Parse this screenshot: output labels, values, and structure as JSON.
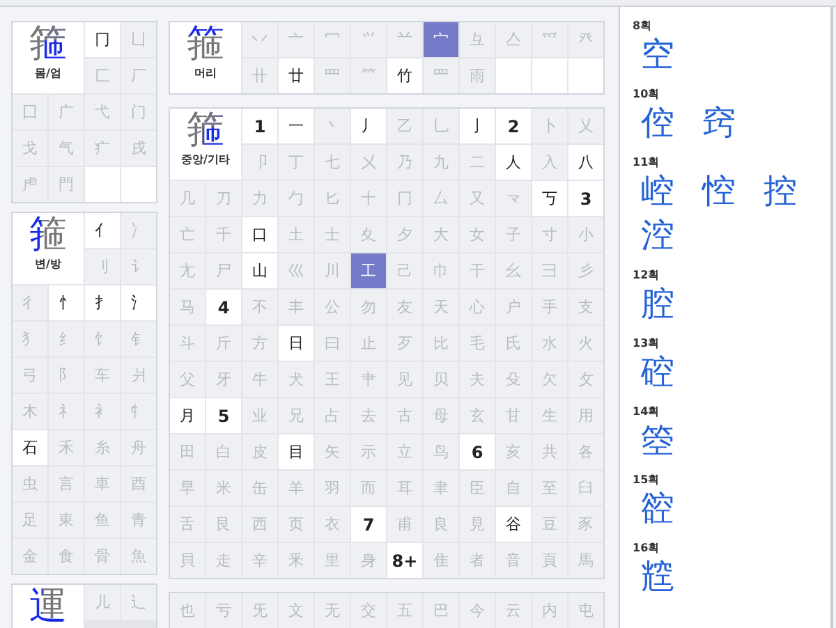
{
  "left_column": [
    {
      "label": "몸/엄",
      "char": "箍",
      "kind": "right",
      "cells": [
        {
          "kind": "radical",
          "text": "冂",
          "enabled": true,
          "selected": false
        },
        {
          "kind": "radical",
          "text": "凵",
          "enabled": false,
          "selected": false
        },
        {
          "kind": "radical",
          "text": "匚",
          "enabled": false,
          "selected": false
        },
        {
          "kind": "radical",
          "text": "厂",
          "enabled": false,
          "selected": false
        },
        {
          "kind": "radical",
          "text": "囗",
          "enabled": false,
          "selected": false
        },
        {
          "kind": "radical",
          "text": "广",
          "enabled": false,
          "selected": false
        },
        {
          "kind": "radical",
          "text": "弋",
          "enabled": false,
          "selected": false
        },
        {
          "kind": "radical",
          "text": "门",
          "enabled": false,
          "selected": false
        },
        {
          "kind": "radical",
          "text": "戈",
          "enabled": false,
          "selected": false
        },
        {
          "kind": "radical",
          "text": "气",
          "enabled": false,
          "selected": false
        },
        {
          "kind": "radical",
          "text": "疒",
          "enabled": false,
          "selected": false
        },
        {
          "kind": "radical",
          "text": "戌",
          "enabled": false,
          "selected": false
        },
        {
          "kind": "radical",
          "text": "虍",
          "enabled": false,
          "selected": false
        },
        {
          "kind": "radical",
          "text": "門",
          "enabled": false,
          "selected": false
        },
        {
          "kind": "empty"
        },
        {
          "kind": "empty"
        }
      ]
    },
    {
      "label": "변/방",
      "char": "箍",
      "kind": "left",
      "cells": [
        {
          "kind": "radical",
          "text": "亻",
          "enabled": true,
          "selected": false
        },
        {
          "kind": "radical",
          "text": "冫",
          "enabled": false,
          "selected": false
        },
        {
          "kind": "radical",
          "text": "刂",
          "enabled": false,
          "selected": false
        },
        {
          "kind": "radical",
          "text": "讠",
          "enabled": false,
          "selected": false
        },
        {
          "kind": "radical",
          "text": "彳",
          "enabled": false,
          "selected": false
        },
        {
          "kind": "radical",
          "text": "忄",
          "enabled": true,
          "selected": false
        },
        {
          "kind": "radical",
          "text": "扌",
          "enabled": true,
          "selected": false
        },
        {
          "kind": "radical",
          "text": "氵",
          "enabled": true,
          "selected": false
        },
        {
          "kind": "radical",
          "text": "犭",
          "enabled": false,
          "selected": false
        },
        {
          "kind": "radical",
          "text": "纟",
          "enabled": false,
          "selected": false
        },
        {
          "kind": "radical",
          "text": "饣",
          "enabled": false,
          "selected": false
        },
        {
          "kind": "radical",
          "text": "钅",
          "enabled": false,
          "selected": false
        },
        {
          "kind": "radical",
          "text": "弓",
          "enabled": false,
          "selected": false
        },
        {
          "kind": "radical",
          "text": "阝",
          "enabled": false,
          "selected": false
        },
        {
          "kind": "radical",
          "text": "车",
          "enabled": false,
          "selected": false
        },
        {
          "kind": "radical",
          "text": "爿",
          "enabled": false,
          "selected": false
        },
        {
          "kind": "radical",
          "text": "木",
          "enabled": false,
          "selected": false
        },
        {
          "kind": "radical",
          "text": "礻",
          "enabled": false,
          "selected": false
        },
        {
          "kind": "radical",
          "text": "衤",
          "enabled": false,
          "selected": false
        },
        {
          "kind": "radical",
          "text": "牜",
          "enabled": false,
          "selected": false
        },
        {
          "kind": "radical",
          "text": "石",
          "enabled": true,
          "selected": false
        },
        {
          "kind": "radical",
          "text": "禾",
          "enabled": false,
          "selected": false
        },
        {
          "kind": "radical",
          "text": "糸",
          "enabled": false,
          "selected": false
        },
        {
          "kind": "radical",
          "text": "舟",
          "enabled": false,
          "selected": false
        },
        {
          "kind": "radical",
          "text": "虫",
          "enabled": false,
          "selected": false
        },
        {
          "kind": "radical",
          "text": "言",
          "enabled": false,
          "selected": false
        },
        {
          "kind": "radical",
          "text": "車",
          "enabled": false,
          "selected": false
        },
        {
          "kind": "radical",
          "text": "酉",
          "enabled": false,
          "selected": false
        },
        {
          "kind": "radical",
          "text": "足",
          "enabled": false,
          "selected": false
        },
        {
          "kind": "radical",
          "text": "東",
          "enabled": false,
          "selected": false
        },
        {
          "kind": "radical",
          "text": "鱼",
          "enabled": false,
          "selected": false
        },
        {
          "kind": "radical",
          "text": "青",
          "enabled": false,
          "selected": false
        },
        {
          "kind": "radical",
          "text": "金",
          "enabled": false,
          "selected": false
        },
        {
          "kind": "radical",
          "text": "食",
          "enabled": false,
          "selected": false
        },
        {
          "kind": "radical",
          "text": "骨",
          "enabled": false,
          "selected": false
        },
        {
          "kind": "radical",
          "text": "魚",
          "enabled": false,
          "selected": false
        }
      ]
    },
    {
      "char": "運",
      "kind": "leftbottom",
      "cells": [
        {
          "kind": "radical",
          "text": "儿",
          "enabled": false,
          "selected": false
        },
        {
          "kind": "radical",
          "text": "辶",
          "enabled": false,
          "selected": false
        }
      ]
    }
  ],
  "middle_column": [
    {
      "label": "머리",
      "char": "箍",
      "kind": "top",
      "cells": [
        {
          "kind": "radical",
          "text": "丷",
          "enabled": false,
          "selected": false
        },
        {
          "kind": "radical",
          "text": "亠",
          "enabled": false,
          "selected": false
        },
        {
          "kind": "radical",
          "text": "冖",
          "enabled": false,
          "selected": false
        },
        {
          "kind": "radical",
          "text": "⺍",
          "enabled": false,
          "selected": false
        },
        {
          "kind": "radical",
          "text": "䒑",
          "enabled": false,
          "selected": false
        },
        {
          "kind": "radical",
          "text": "宀",
          "enabled": true,
          "selected": true
        },
        {
          "kind": "radical",
          "text": "彑",
          "enabled": false,
          "selected": false
        },
        {
          "kind": "radical",
          "text": "亼",
          "enabled": false,
          "selected": false
        },
        {
          "kind": "radical",
          "text": "爫",
          "enabled": false,
          "selected": false
        },
        {
          "kind": "radical",
          "text": "癶",
          "enabled": false,
          "selected": false
        },
        {
          "kind": "radical",
          "text": "卄",
          "enabled": false,
          "selected": false
        },
        {
          "kind": "radical",
          "text": "廿",
          "enabled": true,
          "selected": false
        },
        {
          "kind": "radical",
          "text": "罒",
          "enabled": false,
          "selected": false
        },
        {
          "kind": "radical",
          "text": "⺮",
          "enabled": false,
          "selected": false
        },
        {
          "kind": "radical",
          "text": "竹",
          "enabled": true,
          "selected": false
        },
        {
          "kind": "radical",
          "text": "⺲",
          "enabled": false,
          "selected": false
        },
        {
          "kind": "radical",
          "text": "雨",
          "enabled": false,
          "selected": false
        },
        {
          "kind": "empty"
        },
        {
          "kind": "empty"
        },
        {
          "kind": "empty"
        }
      ]
    },
    {
      "label": "중앙/기타",
      "char": "箍",
      "kind": "center",
      "cells": [
        {
          "kind": "stroke",
          "text": "1"
        },
        {
          "kind": "radical",
          "text": "一",
          "enabled": true,
          "selected": false
        },
        {
          "kind": "radical",
          "text": "丶",
          "enabled": false,
          "selected": false
        },
        {
          "kind": "radical",
          "text": "丿",
          "enabled": true,
          "selected": false
        },
        {
          "kind": "radical",
          "text": "乙",
          "enabled": false,
          "selected": false
        },
        {
          "kind": "radical",
          "text": "乚",
          "enabled": false,
          "selected": false
        },
        {
          "kind": "radical",
          "text": "亅",
          "enabled": true,
          "selected": false
        },
        {
          "kind": "stroke",
          "text": "2"
        },
        {
          "kind": "radical",
          "text": "卜",
          "enabled": false,
          "selected": false
        },
        {
          "kind": "radical",
          "text": "乂",
          "enabled": false,
          "selected": false
        },
        {
          "kind": "radical",
          "text": "卩",
          "enabled": false,
          "selected": false
        },
        {
          "kind": "radical",
          "text": "丁",
          "enabled": false,
          "selected": false
        },
        {
          "kind": "radical",
          "text": "七",
          "enabled": false,
          "selected": false
        },
        {
          "kind": "radical",
          "text": "㐅",
          "enabled": false,
          "selected": false
        },
        {
          "kind": "radical",
          "text": "乃",
          "enabled": false,
          "selected": false
        },
        {
          "kind": "radical",
          "text": "九",
          "enabled": false,
          "selected": false
        },
        {
          "kind": "radical",
          "text": "二",
          "enabled": false,
          "selected": false
        },
        {
          "kind": "radical",
          "text": "人",
          "enabled": true,
          "selected": false
        },
        {
          "kind": "radical",
          "text": "入",
          "enabled": false,
          "selected": false
        },
        {
          "kind": "radical",
          "text": "八",
          "enabled": true,
          "selected": false
        },
        {
          "kind": "radical",
          "text": "几",
          "enabled": false,
          "selected": false
        },
        {
          "kind": "radical",
          "text": "刀",
          "enabled": false,
          "selected": false
        },
        {
          "kind": "radical",
          "text": "力",
          "enabled": false,
          "selected": false
        },
        {
          "kind": "radical",
          "text": "勹",
          "enabled": false,
          "selected": false
        },
        {
          "kind": "radical",
          "text": "匕",
          "enabled": false,
          "selected": false
        },
        {
          "kind": "radical",
          "text": "十",
          "enabled": false,
          "selected": false
        },
        {
          "kind": "radical",
          "text": "冂",
          "enabled": false,
          "selected": false
        },
        {
          "kind": "radical",
          "text": "厶",
          "enabled": false,
          "selected": false
        },
        {
          "kind": "radical",
          "text": "又",
          "enabled": false,
          "selected": false
        },
        {
          "kind": "radical",
          "text": "龴",
          "enabled": false,
          "selected": false
        },
        {
          "kind": "radical",
          "text": "丂",
          "enabled": true,
          "selected": false
        },
        {
          "kind": "stroke",
          "text": "3"
        },
        {
          "kind": "radical",
          "text": "亡",
          "enabled": false,
          "selected": false
        },
        {
          "kind": "radical",
          "text": "千",
          "enabled": false,
          "selected": false
        },
        {
          "kind": "radical",
          "text": "口",
          "enabled": true,
          "selected": false
        },
        {
          "kind": "radical",
          "text": "土",
          "enabled": false,
          "selected": false
        },
        {
          "kind": "radical",
          "text": "士",
          "enabled": false,
          "selected": false
        },
        {
          "kind": "radical",
          "text": "夊",
          "enabled": false,
          "selected": false
        },
        {
          "kind": "radical",
          "text": "夕",
          "enabled": false,
          "selected": false
        },
        {
          "kind": "radical",
          "text": "大",
          "enabled": false,
          "selected": false
        },
        {
          "kind": "radical",
          "text": "女",
          "enabled": false,
          "selected": false
        },
        {
          "kind": "radical",
          "text": "子",
          "enabled": false,
          "selected": false
        },
        {
          "kind": "radical",
          "text": "寸",
          "enabled": false,
          "selected": false
        },
        {
          "kind": "radical",
          "text": "小",
          "enabled": false,
          "selected": false
        },
        {
          "kind": "radical",
          "text": "尢",
          "enabled": false,
          "selected": false
        },
        {
          "kind": "radical",
          "text": "尸",
          "enabled": false,
          "selected": false
        },
        {
          "kind": "radical",
          "text": "山",
          "enabled": true,
          "selected": false
        },
        {
          "kind": "radical",
          "text": "巛",
          "enabled": false,
          "selected": false
        },
        {
          "kind": "radical",
          "text": "川",
          "enabled": false,
          "selected": false
        },
        {
          "kind": "radical",
          "text": "工",
          "enabled": true,
          "selected": true
        },
        {
          "kind": "radical",
          "text": "己",
          "enabled": false,
          "selected": false
        },
        {
          "kind": "radical",
          "text": "巾",
          "enabled": false,
          "selected": false
        },
        {
          "kind": "radical",
          "text": "干",
          "enabled": false,
          "selected": false
        },
        {
          "kind": "radical",
          "text": "幺",
          "enabled": false,
          "selected": false
        },
        {
          "kind": "radical",
          "text": "彐",
          "enabled": false,
          "selected": false
        },
        {
          "kind": "radical",
          "text": "彡",
          "enabled": false,
          "selected": false
        },
        {
          "kind": "radical",
          "text": "马",
          "enabled": false,
          "selected": false
        },
        {
          "kind": "stroke",
          "text": "4"
        },
        {
          "kind": "radical",
          "text": "不",
          "enabled": false,
          "selected": false
        },
        {
          "kind": "radical",
          "text": "丰",
          "enabled": false,
          "selected": false
        },
        {
          "kind": "radical",
          "text": "公",
          "enabled": false,
          "selected": false
        },
        {
          "kind": "radical",
          "text": "勿",
          "enabled": false,
          "selected": false
        },
        {
          "kind": "radical",
          "text": "友",
          "enabled": false,
          "selected": false
        },
        {
          "kind": "radical",
          "text": "天",
          "enabled": false,
          "selected": false
        },
        {
          "kind": "radical",
          "text": "心",
          "enabled": false,
          "selected": false
        },
        {
          "kind": "radical",
          "text": "户",
          "enabled": false,
          "selected": false
        },
        {
          "kind": "radical",
          "text": "手",
          "enabled": false,
          "selected": false
        },
        {
          "kind": "radical",
          "text": "支",
          "enabled": false,
          "selected": false
        },
        {
          "kind": "radical",
          "text": "斗",
          "enabled": false,
          "selected": false
        },
        {
          "kind": "radical",
          "text": "斤",
          "enabled": false,
          "selected": false
        },
        {
          "kind": "radical",
          "text": "方",
          "enabled": false,
          "selected": false
        },
        {
          "kind": "radical",
          "text": "日",
          "enabled": true,
          "selected": false
        },
        {
          "kind": "radical",
          "text": "曰",
          "enabled": false,
          "selected": false
        },
        {
          "kind": "radical",
          "text": "止",
          "enabled": false,
          "selected": false
        },
        {
          "kind": "radical",
          "text": "歹",
          "enabled": false,
          "selected": false
        },
        {
          "kind": "radical",
          "text": "比",
          "enabled": false,
          "selected": false
        },
        {
          "kind": "radical",
          "text": "毛",
          "enabled": false,
          "selected": false
        },
        {
          "kind": "radical",
          "text": "氏",
          "enabled": false,
          "selected": false
        },
        {
          "kind": "radical",
          "text": "水",
          "enabled": false,
          "selected": false
        },
        {
          "kind": "radical",
          "text": "火",
          "enabled": false,
          "selected": false
        },
        {
          "kind": "radical",
          "text": "父",
          "enabled": false,
          "selected": false
        },
        {
          "kind": "radical",
          "text": "牙",
          "enabled": false,
          "selected": false
        },
        {
          "kind": "radical",
          "text": "牛",
          "enabled": false,
          "selected": false
        },
        {
          "kind": "radical",
          "text": "犬",
          "enabled": false,
          "selected": false
        },
        {
          "kind": "radical",
          "text": "王",
          "enabled": false,
          "selected": false
        },
        {
          "kind": "radical",
          "text": "肀",
          "enabled": false,
          "selected": false
        },
        {
          "kind": "radical",
          "text": "见",
          "enabled": false,
          "selected": false
        },
        {
          "kind": "radical",
          "text": "贝",
          "enabled": false,
          "selected": false
        },
        {
          "kind": "radical",
          "text": "夫",
          "enabled": false,
          "selected": false
        },
        {
          "kind": "radical",
          "text": "殳",
          "enabled": false,
          "selected": false
        },
        {
          "kind": "radical",
          "text": "欠",
          "enabled": false,
          "selected": false
        },
        {
          "kind": "radical",
          "text": "攵",
          "enabled": false,
          "selected": false
        },
        {
          "kind": "radical",
          "text": "月",
          "enabled": true,
          "selected": false
        },
        {
          "kind": "stroke",
          "text": "5"
        },
        {
          "kind": "radical",
          "text": "业",
          "enabled": false,
          "selected": false
        },
        {
          "kind": "radical",
          "text": "兄",
          "enabled": false,
          "selected": false
        },
        {
          "kind": "radical",
          "text": "占",
          "enabled": false,
          "selected": false
        },
        {
          "kind": "radical",
          "text": "去",
          "enabled": false,
          "selected": false
        },
        {
          "kind": "radical",
          "text": "古",
          "enabled": false,
          "selected": false
        },
        {
          "kind": "radical",
          "text": "母",
          "enabled": false,
          "selected": false
        },
        {
          "kind": "radical",
          "text": "玄",
          "enabled": false,
          "selected": false
        },
        {
          "kind": "radical",
          "text": "甘",
          "enabled": false,
          "selected": false
        },
        {
          "kind": "radical",
          "text": "生",
          "enabled": false,
          "selected": false
        },
        {
          "kind": "radical",
          "text": "用",
          "enabled": false,
          "selected": false
        },
        {
          "kind": "radical",
          "text": "田",
          "enabled": false,
          "selected": false
        },
        {
          "kind": "radical",
          "text": "白",
          "enabled": false,
          "selected": false
        },
        {
          "kind": "radical",
          "text": "皮",
          "enabled": false,
          "selected": false
        },
        {
          "kind": "radical",
          "text": "目",
          "enabled": true,
          "selected": false
        },
        {
          "kind": "radical",
          "text": "矢",
          "enabled": false,
          "selected": false
        },
        {
          "kind": "radical",
          "text": "示",
          "enabled": false,
          "selected": false
        },
        {
          "kind": "radical",
          "text": "立",
          "enabled": false,
          "selected": false
        },
        {
          "kind": "radical",
          "text": "鸟",
          "enabled": false,
          "selected": false
        },
        {
          "kind": "stroke",
          "text": "6"
        },
        {
          "kind": "radical",
          "text": "亥",
          "enabled": false,
          "selected": false
        },
        {
          "kind": "radical",
          "text": "共",
          "enabled": false,
          "selected": false
        },
        {
          "kind": "radical",
          "text": "各",
          "enabled": false,
          "selected": false
        },
        {
          "kind": "radical",
          "text": "早",
          "enabled": false,
          "selected": false
        },
        {
          "kind": "radical",
          "text": "米",
          "enabled": false,
          "selected": false
        },
        {
          "kind": "radical",
          "text": "缶",
          "enabled": false,
          "selected": false
        },
        {
          "kind": "radical",
          "text": "羊",
          "enabled": false,
          "selected": false
        },
        {
          "kind": "radical",
          "text": "羽",
          "enabled": false,
          "selected": false
        },
        {
          "kind": "radical",
          "text": "而",
          "enabled": false,
          "selected": false
        },
        {
          "kind": "radical",
          "text": "耳",
          "enabled": false,
          "selected": false
        },
        {
          "kind": "radical",
          "text": "聿",
          "enabled": false,
          "selected": false
        },
        {
          "kind": "radical",
          "text": "臣",
          "enabled": false,
          "selected": false
        },
        {
          "kind": "radical",
          "text": "自",
          "enabled": false,
          "selected": false
        },
        {
          "kind": "radical",
          "text": "至",
          "enabled": false,
          "selected": false
        },
        {
          "kind": "radical",
          "text": "臼",
          "enabled": false,
          "selected": false
        },
        {
          "kind": "radical",
          "text": "舌",
          "enabled": false,
          "selected": false
        },
        {
          "kind": "radical",
          "text": "艮",
          "enabled": false,
          "selected": false
        },
        {
          "kind": "radical",
          "text": "西",
          "enabled": false,
          "selected": false
        },
        {
          "kind": "radical",
          "text": "页",
          "enabled": false,
          "selected": false
        },
        {
          "kind": "radical",
          "text": "衣",
          "enabled": false,
          "selected": false
        },
        {
          "kind": "stroke",
          "text": "7"
        },
        {
          "kind": "radical",
          "text": "甫",
          "enabled": false,
          "selected": false
        },
        {
          "kind": "radical",
          "text": "良",
          "enabled": false,
          "selected": false
        },
        {
          "kind": "radical",
          "text": "見",
          "enabled": false,
          "selected": false
        },
        {
          "kind": "radical",
          "text": "谷",
          "enabled": true,
          "selected": false
        },
        {
          "kind": "radical",
          "text": "豆",
          "enabled": false,
          "selected": false
        },
        {
          "kind": "radical",
          "text": "豕",
          "enabled": false,
          "selected": false
        },
        {
          "kind": "radical",
          "text": "貝",
          "enabled": false,
          "selected": false
        },
        {
          "kind": "radical",
          "text": "走",
          "enabled": false,
          "selected": false
        },
        {
          "kind": "radical",
          "text": "辛",
          "enabled": false,
          "selected": false
        },
        {
          "kind": "radical",
          "text": "釆",
          "enabled": false,
          "selected": false
        },
        {
          "kind": "radical",
          "text": "里",
          "enabled": false,
          "selected": false
        },
        {
          "kind": "radical",
          "text": "身",
          "enabled": false,
          "selected": false
        },
        {
          "kind": "stroke",
          "text": "8+"
        },
        {
          "kind": "radical",
          "text": "隹",
          "enabled": false,
          "selected": false
        },
        {
          "kind": "radical",
          "text": "者",
          "enabled": false,
          "selected": false
        },
        {
          "kind": "radical",
          "text": "音",
          "enabled": false,
          "selected": false
        },
        {
          "kind": "radical",
          "text": "頁",
          "enabled": false,
          "selected": false
        },
        {
          "kind": "radical",
          "text": "馬",
          "enabled": false,
          "selected": false
        }
      ]
    },
    {
      "cells": [
        {
          "kind": "radical",
          "text": "也",
          "enabled": false,
          "selected": false
        },
        {
          "kind": "radical",
          "text": "亏",
          "enabled": false,
          "selected": false
        },
        {
          "kind": "radical",
          "text": "旡",
          "enabled": false,
          "selected": false
        },
        {
          "kind": "radical",
          "text": "文",
          "enabled": false,
          "selected": false
        },
        {
          "kind": "radical",
          "text": "无",
          "enabled": false,
          "selected": false
        },
        {
          "kind": "radical",
          "text": "交",
          "enabled": false,
          "selected": false
        },
        {
          "kind": "radical",
          "text": "五",
          "enabled": false,
          "selected": false
        },
        {
          "kind": "radical",
          "text": "巴",
          "enabled": false,
          "selected": false
        },
        {
          "kind": "radical",
          "text": "今",
          "enabled": false,
          "selected": false
        },
        {
          "kind": "radical",
          "text": "云",
          "enabled": false,
          "selected": false
        },
        {
          "kind": "radical",
          "text": "内",
          "enabled": false,
          "selected": false
        },
        {
          "kind": "radical",
          "text": "屯",
          "enabled": false,
          "selected": false
        }
      ]
    }
  ],
  "results": [
    {
      "strokes": "8획",
      "chars": [
        "空"
      ]
    },
    {
      "strokes": "10획",
      "chars": [
        "倥",
        "窍"
      ]
    },
    {
      "strokes": "11획",
      "chars": [
        "崆",
        "悾",
        "控",
        "涳"
      ]
    },
    {
      "strokes": "12획",
      "chars": [
        "腔"
      ]
    },
    {
      "strokes": "13획",
      "chars": [
        "硿"
      ]
    },
    {
      "strokes": "14획",
      "chars": [
        "箜"
      ]
    },
    {
      "strokes": "15획",
      "chars": [
        "谾"
      ]
    },
    {
      "strokes": "16획",
      "chars": [
        "䆪"
      ]
    }
  ]
}
